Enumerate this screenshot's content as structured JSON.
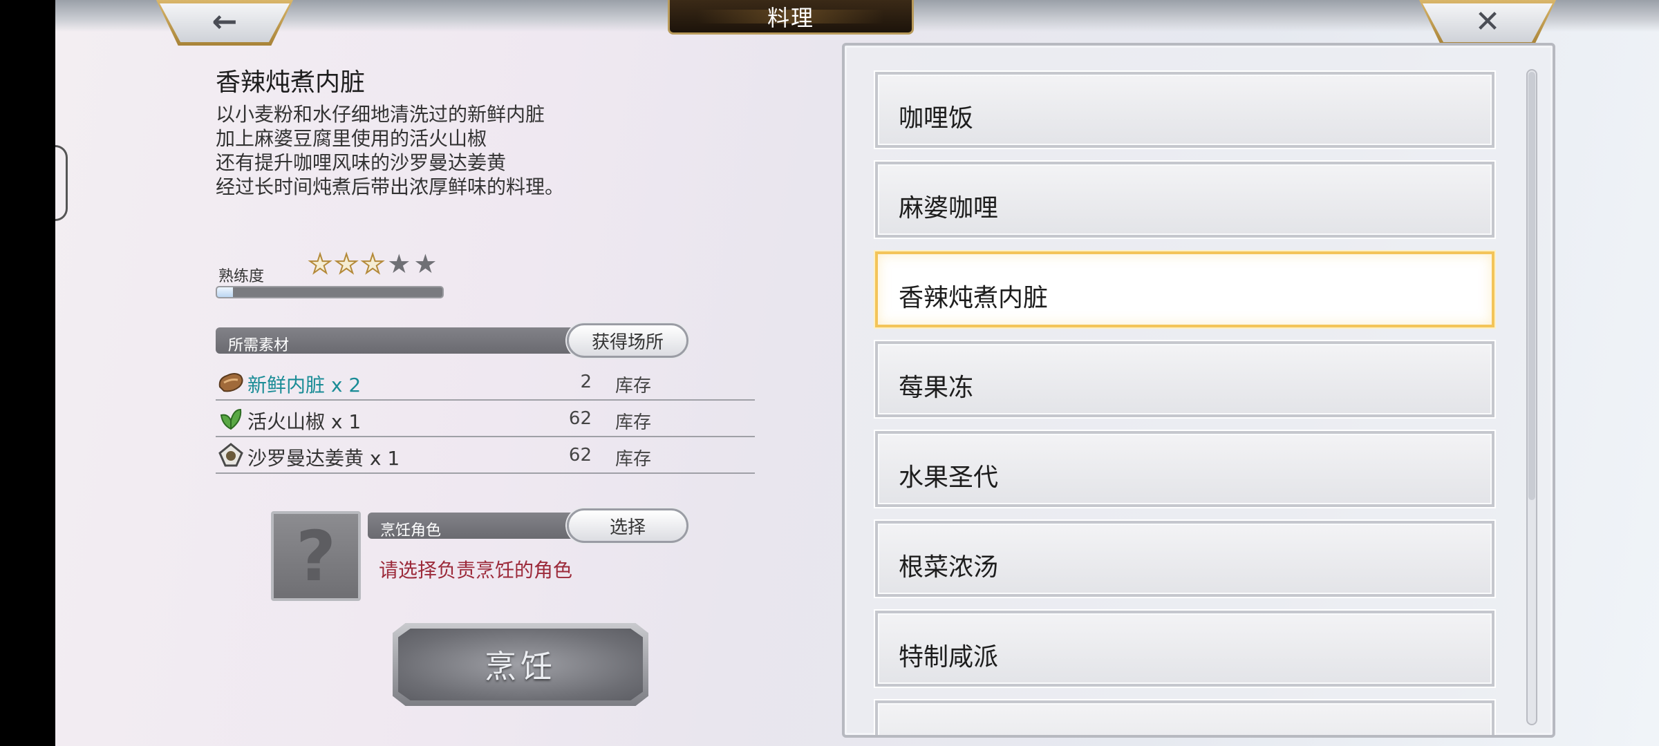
{
  "header": {
    "title": "料理",
    "back_icon": "←",
    "close_icon": "✕"
  },
  "dish": {
    "name": "香辣炖煮内脏",
    "description": "以小麦粉和水仔细地清洗过的新鲜内脏\n加上麻婆豆腐里使用的活火山椒\n还有提升咖哩风味的沙罗曼达姜黄\n经过长时间炖煮后带出浓厚鲜味的料理。"
  },
  "proficiency": {
    "label": "熟练度",
    "stars_total": 5,
    "stars_filled": 3,
    "progress": 0.07
  },
  "materials": {
    "header": "所需素材",
    "source_button": "获得场所",
    "items": [
      {
        "name": "新鲜内脏 x 2",
        "stock_label": "库存",
        "stock": "2",
        "icon": "organ-icon"
      },
      {
        "name": "活火山椒 x 1",
        "stock_label": "库存",
        "stock": "62",
        "icon": "herb-icon"
      },
      {
        "name": "沙罗曼达姜黄 x 1",
        "stock_label": "库存",
        "stock": "62",
        "icon": "spice-icon"
      }
    ]
  },
  "chef": {
    "header": "烹饪角色",
    "select_button": "选择",
    "placeholder_glyph": "?",
    "hint": "请选择负责烹饪的角色"
  },
  "cook_button": "烹饪",
  "recipes": {
    "items": [
      "咖哩饭",
      "麻婆咖哩",
      "香辣炖煮内脏",
      "莓果冻",
      "水果圣代",
      "根菜浓汤",
      "特制咸派"
    ],
    "selected_index": 2
  },
  "colors": {
    "accent_gold": "#f3c459",
    "highlight_teal": "#1a8c96",
    "hint_red": "#9c2a3a"
  }
}
